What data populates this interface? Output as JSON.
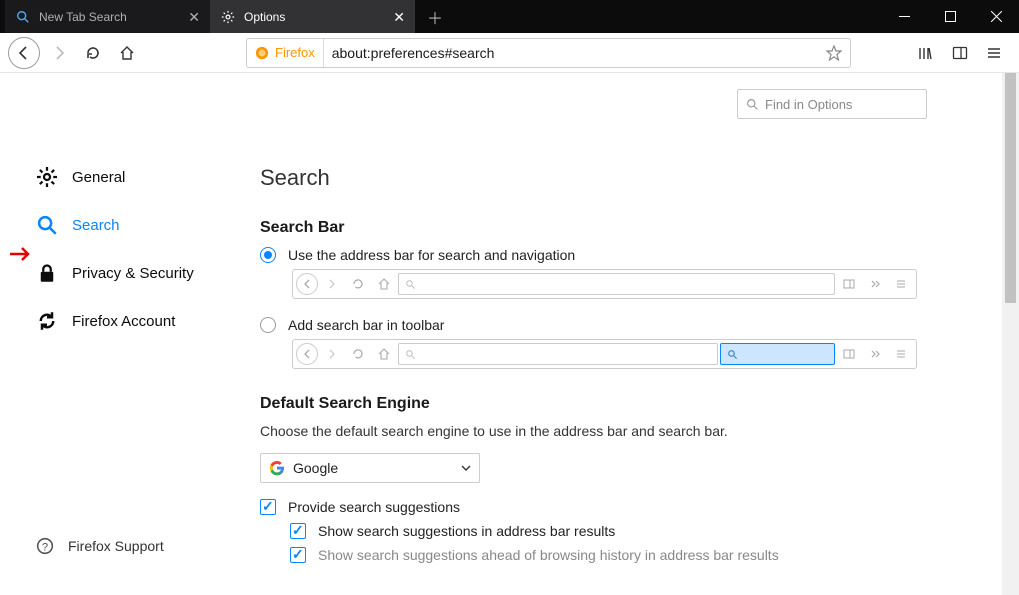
{
  "tabs": [
    {
      "label": "New Tab Search",
      "active": false
    },
    {
      "label": "Options",
      "active": true
    }
  ],
  "url": {
    "identity": "Firefox",
    "value": "about:preferences#search"
  },
  "findPlaceholder": "Find in Options",
  "sidebar": {
    "items": [
      {
        "label": "General"
      },
      {
        "label": "Search"
      },
      {
        "label": "Privacy & Security"
      },
      {
        "label": "Firefox Account"
      }
    ],
    "footer": "Firefox Support"
  },
  "page": {
    "title": "Search",
    "sectionSearchBar": "Search Bar",
    "optAddressBar": "Use the address bar for search and navigation",
    "optSearchBar": "Add search bar in toolbar",
    "sectionDefaultEngine": "Default Search Engine",
    "engineDesc": "Choose the default search engine to use in the address bar and search bar.",
    "engineSelected": "Google",
    "chkSuggestions": "Provide search suggestions",
    "chkSuggestAddress": "Show search suggestions in address bar results",
    "chkSuggestAhead": "Show search suggestions ahead of browsing history in address bar results"
  }
}
